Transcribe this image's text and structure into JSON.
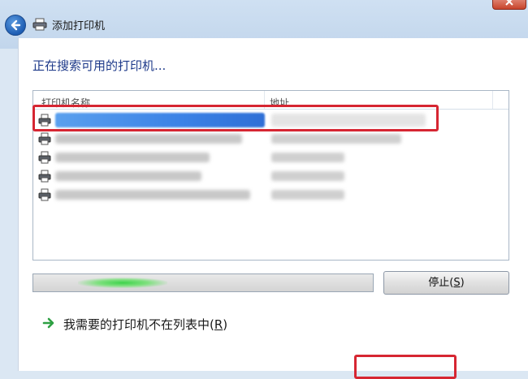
{
  "window": {
    "title": "添加打印机",
    "icons": {
      "back": "back-arrow-icon",
      "title": "printer-icon",
      "close": "close-icon"
    }
  },
  "main": {
    "heading": "正在搜索可用的打印机...",
    "list": {
      "columns": {
        "name": "打印机名称",
        "address": "地址"
      },
      "rows": [
        {
          "selected": true
        },
        {
          "selected": false
        },
        {
          "selected": false
        },
        {
          "selected": false
        },
        {
          "selected": false
        }
      ]
    },
    "progress": {
      "state": "indeterminate"
    },
    "stop_button": {
      "label": "停止(",
      "mnemonic": "S",
      "suffix": ")"
    },
    "not_listed_link": {
      "label": "我需要的打印机不在列表中(",
      "mnemonic": "R",
      "suffix": ")"
    }
  },
  "colors": {
    "highlight_box": "#d62632",
    "heading": "#1e3a8a",
    "link_arrow": "#2ea043"
  }
}
